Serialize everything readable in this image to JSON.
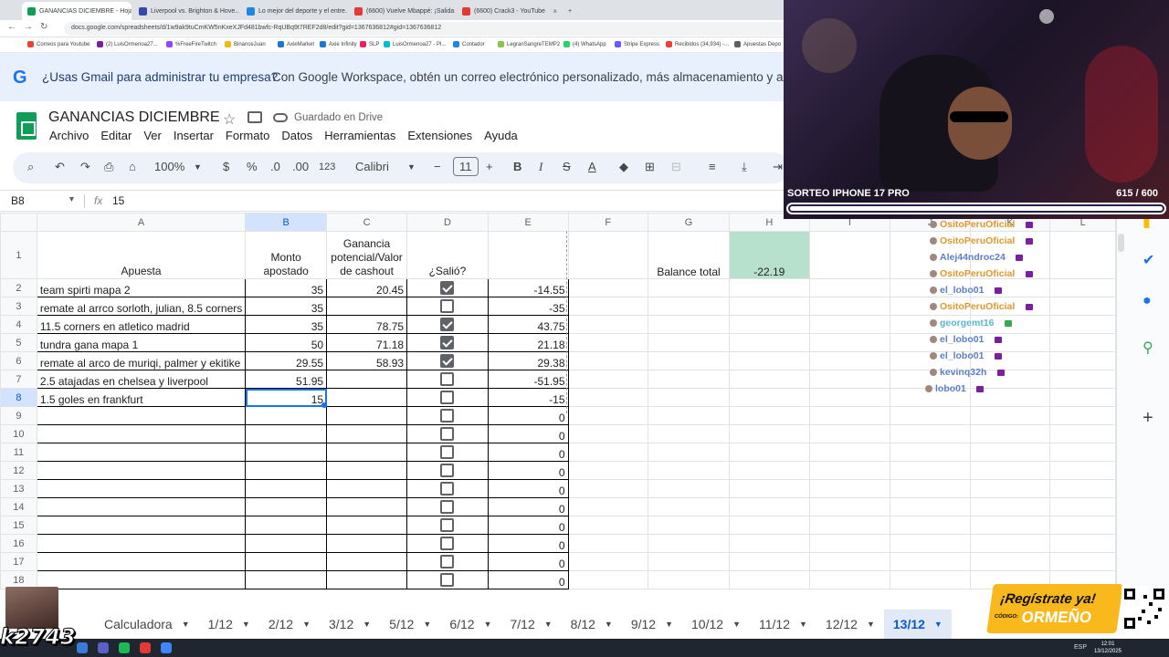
{
  "browser": {
    "tabs": [
      {
        "title": "GANANCIAS DICIEMBRE - Hoja...",
        "color": "#0f9d58",
        "active": true
      },
      {
        "title": "Liverpool vs. Brighton & Hove...",
        "color": "#3949ab",
        "active": false
      },
      {
        "title": "Lo mejor del deporte y el entre...",
        "color": "#1e88e5",
        "active": false
      },
      {
        "title": "(6600) Vuelve Mbappé: ¡Salida...",
        "color": "#e53935",
        "active": false
      },
      {
        "title": "(6600) Crack3 - YouTube",
        "color": "#e53935",
        "active": false
      }
    ],
    "url": "docs.google.com/spreadsheets/d/1w9ak9tuCmKW5nKxeXJFd481bwfc-RqUBq9t7REF2d8/edit?gid=1367636812#gid=1367636812",
    "bookmarks": [
      {
        "label": "Correos para Youtube",
        "color": "#ea4335"
      },
      {
        "label": "(2) LuisOrmenoa27...",
        "color": "#7b1fa2"
      },
      {
        "label": "%FreeFireTwitch",
        "color": "#9146ff"
      },
      {
        "label": "BinanceJuan",
        "color": "#f0b90b"
      },
      {
        "label": "AxieMarket",
        "color": "#1976d2"
      },
      {
        "label": "Axie Infinity",
        "color": "#1976d2"
      },
      {
        "label": "SLP",
        "color": "#e91e63"
      },
      {
        "label": "LuisOrmenoa27 - Pl...",
        "color": "#00bcd4"
      },
      {
        "label": "Contador",
        "color": "#1e88e5"
      },
      {
        "label": "LegranSangreTEMP2",
        "color": "#8bc34a"
      },
      {
        "label": "(4) WhatsApp",
        "color": "#25d366"
      },
      {
        "label": "Stripe Express",
        "color": "#635bff"
      },
      {
        "label": "Recibidos (34,934) -...",
        "color": "#ea4335"
      },
      {
        "label": "Apuestas Depo",
        "color": "#5f6368"
      }
    ]
  },
  "banner": {
    "logo": "G",
    "question": "¿Usas Gmail para administrar tu empresa?",
    "description": "Con Google Workspace, obtén un correo electrónico personalizado, más almacenamiento y asistencia"
  },
  "doc": {
    "title": "GANANCIAS DICIEMBRE",
    "saved_status": "Guardado en Drive",
    "menus": [
      "Archivo",
      "Editar",
      "Ver",
      "Insertar",
      "Formato",
      "Datos",
      "Herramientas",
      "Extensiones",
      "Ayuda"
    ]
  },
  "toolbar": {
    "zoom": "100%",
    "currency": "$",
    "percent": "%",
    "dec_decrease": ".0",
    "dec_increase": ".00",
    "number_format": "123",
    "font": "Calibri",
    "font_size": "11"
  },
  "formula_bar": {
    "cell_ref": "B8",
    "value": "15"
  },
  "sheet": {
    "columns": [
      "A",
      "B",
      "C",
      "D",
      "E",
      "F",
      "G",
      "H",
      "I",
      "J",
      "K",
      "L"
    ],
    "selected_column": "B",
    "selected_row": "8",
    "headers": {
      "a": "Apuesta",
      "b": "Monto apostado",
      "c": "Ganancia potencial/Valor de cashout",
      "d": "¿Salió?"
    },
    "balance_label": "Balance total",
    "balance_value": "-22.19",
    "rows": [
      {
        "n": "2",
        "a": "team spirti mapa 2",
        "b": "35",
        "c": "20.45",
        "d": true,
        "e": "-14.55"
      },
      {
        "n": "3",
        "a": "remate al arrco sorloth, julian, 8.5 corners",
        "b": "35",
        "c": "",
        "d": false,
        "e": "-35"
      },
      {
        "n": "4",
        "a": "11.5 corners en atletico madrid",
        "b": "35",
        "c": "78.75",
        "d": true,
        "e": "43.75"
      },
      {
        "n": "5",
        "a": "tundra gana mapa 1",
        "b": "50",
        "c": "71.18",
        "d": true,
        "e": "21.18"
      },
      {
        "n": "6",
        "a": "remate al arco de muriqi, palmer y ekitike",
        "b": "29.55",
        "c": "58.93",
        "d": true,
        "e": "29.38"
      },
      {
        "n": "7",
        "a": "2.5 atajadas en chelsea y liverpool",
        "b": "51.95",
        "c": "",
        "d": false,
        "e": "-51.95"
      },
      {
        "n": "8",
        "a": "1.5 goles en frankfurt",
        "b": "15",
        "c": "",
        "d": false,
        "e": "-15"
      },
      {
        "n": "9",
        "a": "",
        "b": "",
        "c": "",
        "d": false,
        "e": "0"
      },
      {
        "n": "10",
        "a": "",
        "b": "",
        "c": "",
        "d": false,
        "e": "0"
      },
      {
        "n": "11",
        "a": "",
        "b": "",
        "c": "",
        "d": false,
        "e": "0"
      },
      {
        "n": "12",
        "a": "",
        "b": "",
        "c": "",
        "d": false,
        "e": "0"
      },
      {
        "n": "13",
        "a": "",
        "b": "",
        "c": "",
        "d": false,
        "e": "0"
      },
      {
        "n": "14",
        "a": "",
        "b": "",
        "c": "",
        "d": false,
        "e": "0"
      },
      {
        "n": "15",
        "a": "",
        "b": "",
        "c": "",
        "d": false,
        "e": "0"
      },
      {
        "n": "16",
        "a": "",
        "b": "",
        "c": "",
        "d": false,
        "e": "0"
      },
      {
        "n": "17",
        "a": "",
        "b": "",
        "c": "",
        "d": false,
        "e": "0"
      },
      {
        "n": "18",
        "a": "",
        "b": "",
        "c": "",
        "d": false,
        "e": "0"
      }
    ]
  },
  "chat": [
    {
      "user": "OsitoPeruOficial",
      "text": ":",
      "color": "#e0982c",
      "emote": true
    },
    {
      "user": "OsitoPeruOficial",
      "text": ":",
      "color": "#e0982c",
      "emote": true
    },
    {
      "user": "Alej44ndroc24",
      "text": ":",
      "color": "#5b7fc7",
      "emote": true
    },
    {
      "user": "OsitoPeruOficial",
      "text": ":",
      "color": "#e0982c",
      "emote": true
    },
    {
      "user": "el_lobo01",
      "text": ":",
      "color": "#5b7fc7",
      "emote": true
    },
    {
      "user": "OsitoPeruOficial",
      "text": ":",
      "color": "#e0982c",
      "emote": true
    },
    {
      "user": "georgemt16",
      "text": ":",
      "color": "#5bb8d4",
      "emote": true
    },
    {
      "user": "el_lobo01",
      "text": ":",
      "color": "#5b7fc7",
      "emote": true
    },
    {
      "user": "el_lobo01",
      "text": ":",
      "color": "#5b7fc7",
      "emote": true
    },
    {
      "user": "kevinq32h",
      "text": ":",
      "color": "#5b7fc7",
      "emote": true
    },
    {
      "user": "lobo01",
      "text": ":",
      "color": "#5b7fc7",
      "emote": true
    }
  ],
  "sheet_tabs": [
    "Calculadora",
    "1/12",
    "2/12",
    "3/12",
    "5/12",
    "6/12",
    "7/12",
    "8/12",
    "9/12",
    "10/12",
    "11/12",
    "12/12",
    "13/12"
  ],
  "active_sheet_tab": "13/12",
  "stream": {
    "giveaway_label": "SORTEO IPHONE 17 PRO",
    "progress_text": "615  / 600",
    "progress_fraction": 1.0,
    "promo_line1": "¡Regístrate ya!",
    "promo_code_label": "CÓDIGO:",
    "promo_code": "ORMEÑO",
    "overlay_text": "k2743"
  },
  "taskbar": {
    "tray": "ESP",
    "time": "12:01",
    "date": "13/12/2025"
  }
}
